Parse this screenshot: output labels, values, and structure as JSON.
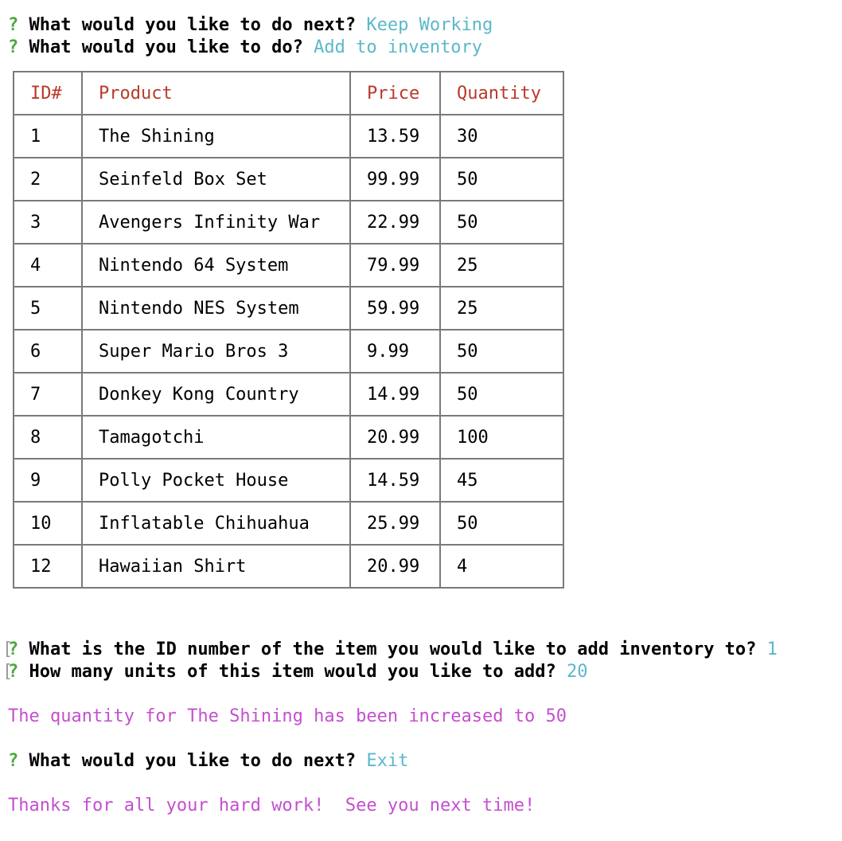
{
  "prompts_top": [
    {
      "marker": "?",
      "question": "What would you like to do next?",
      "answer": "Keep Working"
    },
    {
      "marker": "?",
      "question": "What would you like to do?",
      "answer": "Add to inventory"
    }
  ],
  "table": {
    "headers": [
      "ID#",
      "Product",
      "Price",
      "Quantity"
    ],
    "rows": [
      [
        "1",
        "The Shining",
        "13.59",
        "30"
      ],
      [
        "2",
        "Seinfeld Box Set",
        "99.99",
        "50"
      ],
      [
        "3",
        "Avengers Infinity War",
        "22.99",
        "50"
      ],
      [
        "4",
        "Nintendo 64 System",
        "79.99",
        "25"
      ],
      [
        "5",
        "Nintendo NES System",
        "59.99",
        "25"
      ],
      [
        "6",
        "Super Mario Bros 3",
        "9.99",
        "50"
      ],
      [
        "7",
        "Donkey Kong Country",
        "14.99",
        "50"
      ],
      [
        "8",
        "Tamagotchi",
        "20.99",
        "100"
      ],
      [
        "9",
        "Polly Pocket House",
        "14.59",
        "45"
      ],
      [
        "10",
        "Inflatable Chihuahua",
        "25.99",
        "50"
      ],
      [
        "12",
        "Hawaiian Shirt",
        "20.99",
        "4"
      ]
    ]
  },
  "prompts_add": [
    {
      "bracket": "[",
      "marker": "?",
      "question": "What is the ID number of the item you would like to add inventory to?",
      "answer": "1"
    },
    {
      "bracket": "[",
      "marker": "?",
      "question": "How many units of this item would you like to add?",
      "answer": "20"
    }
  ],
  "result_message": "The quantity for The Shining has been increased to 50",
  "prompt_final": {
    "marker": "?",
    "question": "What would you like to do next?",
    "answer": "Exit"
  },
  "farewell": "Thanks for all your hard work!  See you next time!",
  "colors": {
    "prompt_marker": "#4caa3c",
    "answer": "#5bb8c9",
    "header": "#b83a2a",
    "message": "#c44fcf"
  }
}
